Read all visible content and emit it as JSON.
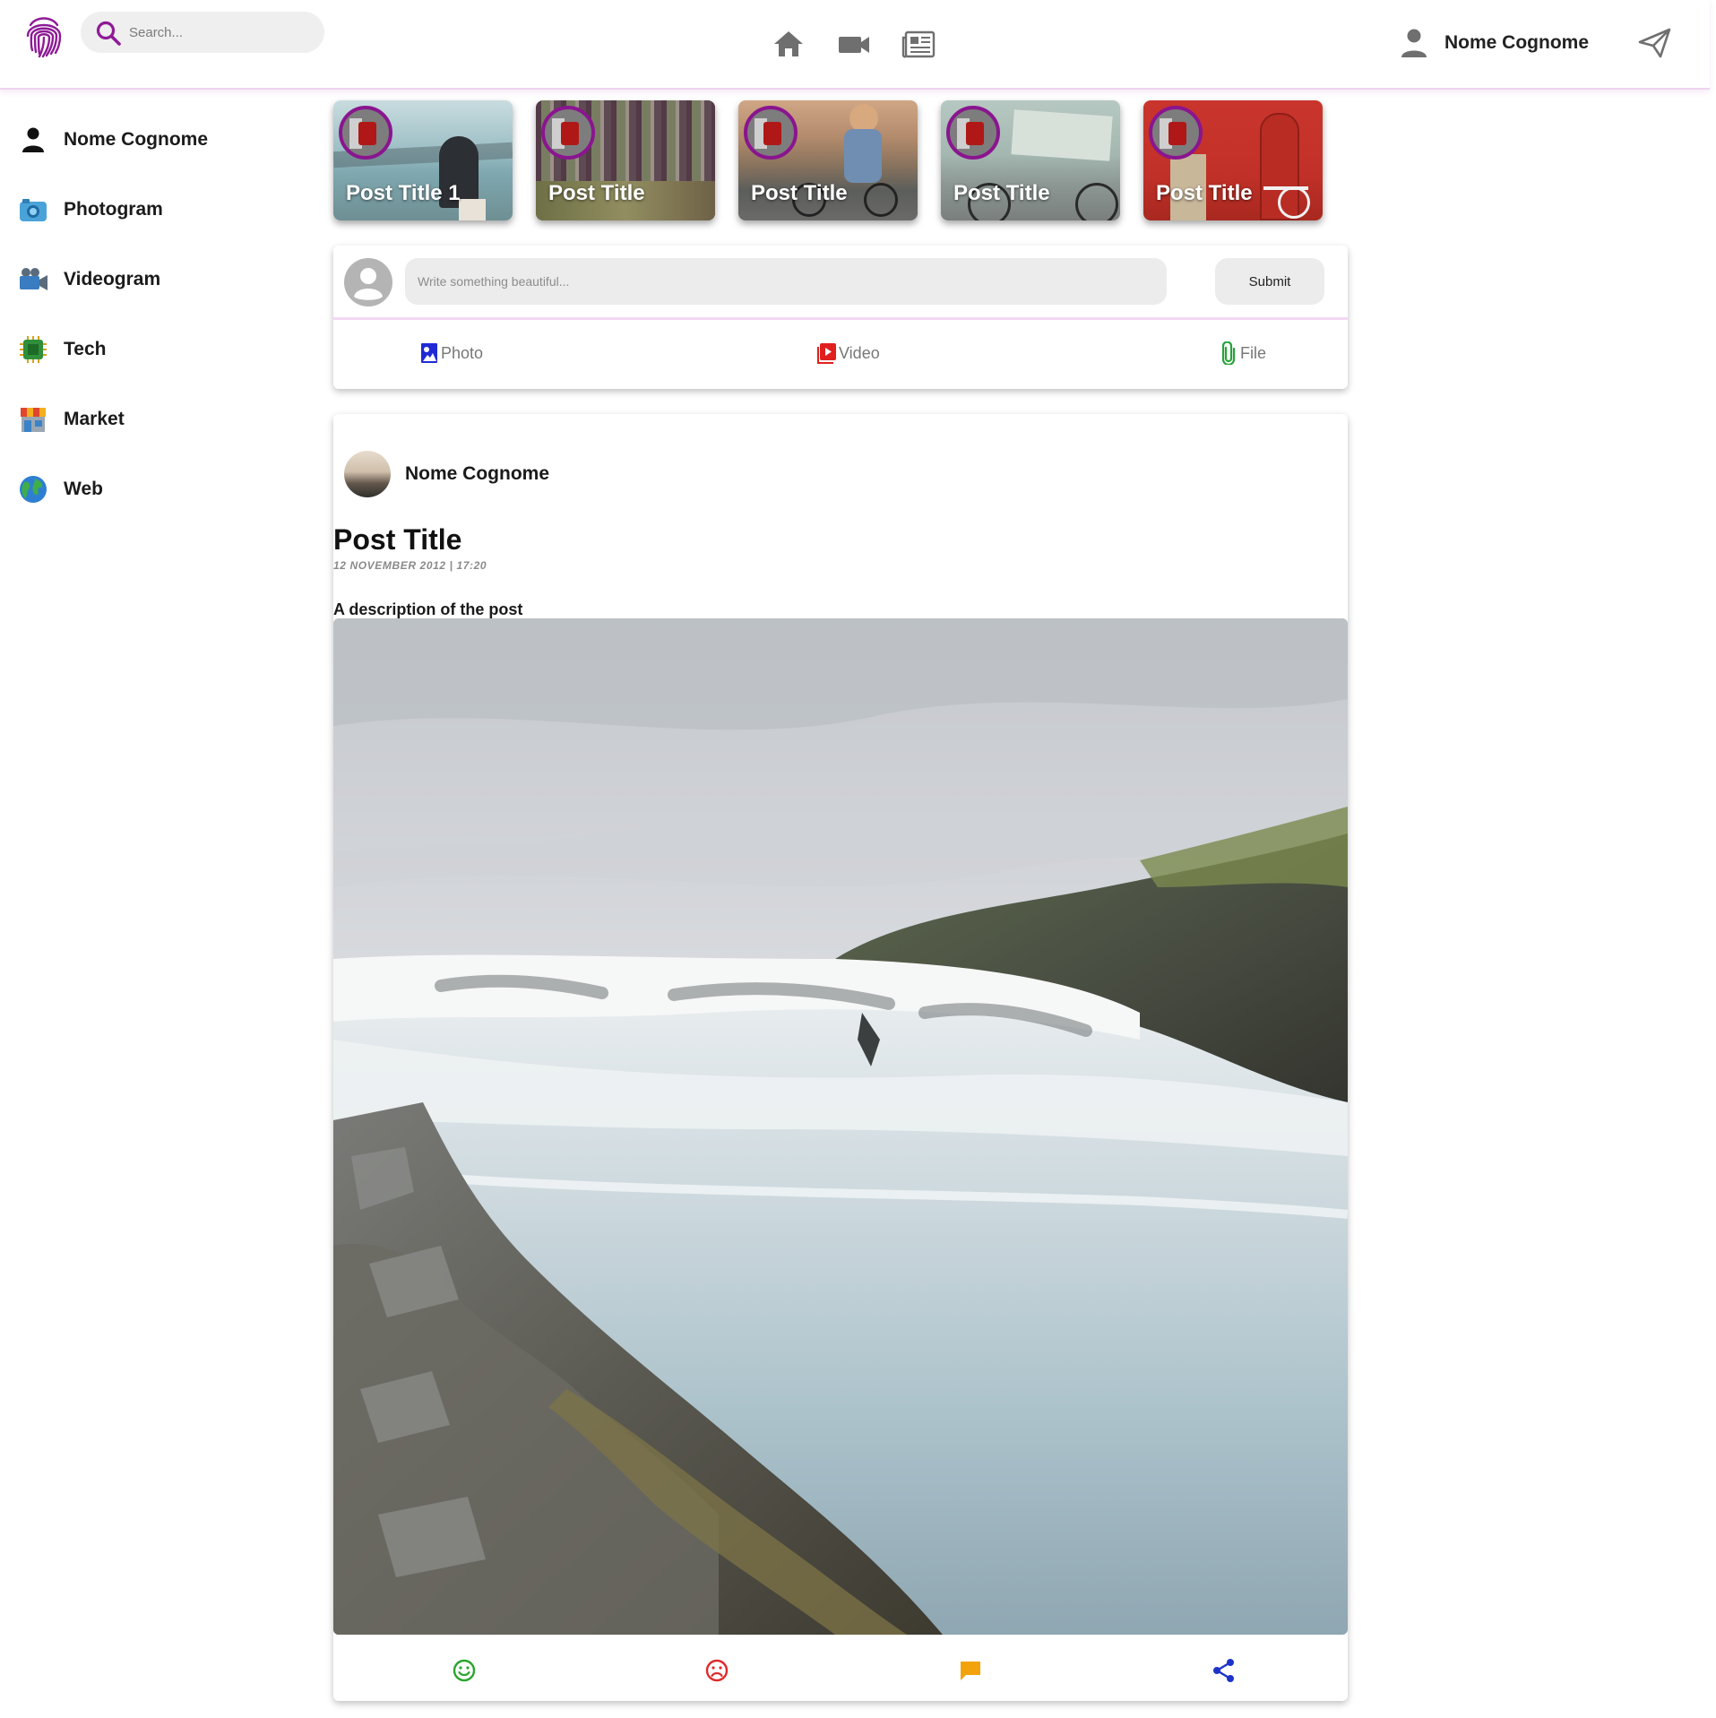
{
  "app": {
    "logo_icon": "fingerprint-icon",
    "accent_color": "#8e1b96"
  },
  "search": {
    "placeholder": "Search...",
    "icon": "search-icon"
  },
  "nav": [
    {
      "name": "home",
      "icon": "home-icon"
    },
    {
      "name": "videos",
      "icon": "video-camera-icon"
    },
    {
      "name": "news",
      "icon": "newspaper-icon"
    }
  ],
  "user": {
    "name": "Nome Cognome",
    "icon": "person-icon"
  },
  "send_icon": "send-icon",
  "sidebar": {
    "items": [
      {
        "label": "Nome Cognome",
        "icon": "person-icon"
      },
      {
        "label": "Photogram",
        "icon": "camera-icon"
      },
      {
        "label": "Videogram",
        "icon": "video-camera-icon"
      },
      {
        "label": "Tech",
        "icon": "chip-icon"
      },
      {
        "label": "Market",
        "icon": "store-icon"
      },
      {
        "label": "Web",
        "icon": "globe-icon"
      }
    ]
  },
  "stories": [
    {
      "title": "Post Title 1"
    },
    {
      "title": "Post Title"
    },
    {
      "title": "Post Title"
    },
    {
      "title": "Post Title"
    },
    {
      "title": "Post Title"
    }
  ],
  "composer": {
    "placeholder": "Write something beautiful...",
    "submit_label": "Submit",
    "options": [
      {
        "label": "Photo",
        "icon": "photo-icon",
        "color": "#1f2ad6"
      },
      {
        "label": "Video",
        "icon": "video-play-icon",
        "color": "#e0201e"
      },
      {
        "label": "File",
        "icon": "paperclip-icon",
        "color": "#27a33a"
      }
    ]
  },
  "post": {
    "author": "Nome Cognome",
    "title": "Post Title",
    "date": "12 NOVEMBER 2012 | 17:20",
    "description": "A description of the post",
    "image": "waterfall-photo",
    "reactions": [
      {
        "name": "like",
        "icon": "smile-icon",
        "color": "#2aa52d"
      },
      {
        "name": "dislike",
        "icon": "frown-icon",
        "color": "#e02a2a"
      },
      {
        "name": "comment",
        "icon": "comment-icon",
        "color": "#f2a30c"
      },
      {
        "name": "share",
        "icon": "share-icon",
        "color": "#1d33c9"
      }
    ]
  }
}
